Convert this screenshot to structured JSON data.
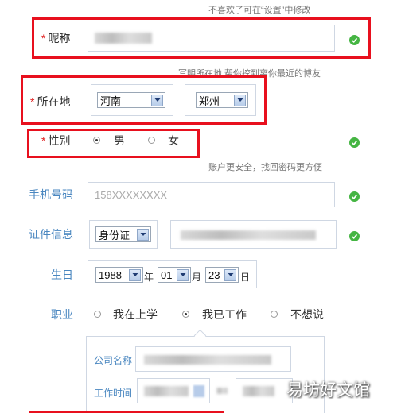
{
  "hints": {
    "nickname": "不喜欢了可在“设置”中修改",
    "location": "写明所在地,帮你挖到离你最近的博友",
    "phone": "账户更安全，找回密码更方便"
  },
  "form": {
    "nickname": {
      "label": "昵称",
      "required": "*"
    },
    "location": {
      "label": "所在地",
      "required": "*",
      "province": "河南",
      "city": "郑州"
    },
    "gender": {
      "label": "性别",
      "required": "*",
      "options": [
        "男",
        "女"
      ],
      "selected": "男"
    },
    "phone": {
      "label": "手机号码",
      "value": "158XXXXXXXX"
    },
    "id_info": {
      "label": "证件信息",
      "type": "身份证"
    },
    "birthday": {
      "label": "生日",
      "year": "1988",
      "year_unit": "年",
      "month": "01",
      "month_unit": "月",
      "day": "23",
      "day_unit": "日"
    },
    "occupation": {
      "label": "职业",
      "options": [
        "我在上学",
        "我已工作",
        "不想说"
      ],
      "selected": "我已工作"
    },
    "work": {
      "company_label": "公司名称",
      "time_label": "工作时间"
    }
  },
  "watermark": "易坊好文馆",
  "colors": {
    "accent": "#4a87c0",
    "highlight": "#e8101e",
    "ok": "#45b543"
  }
}
